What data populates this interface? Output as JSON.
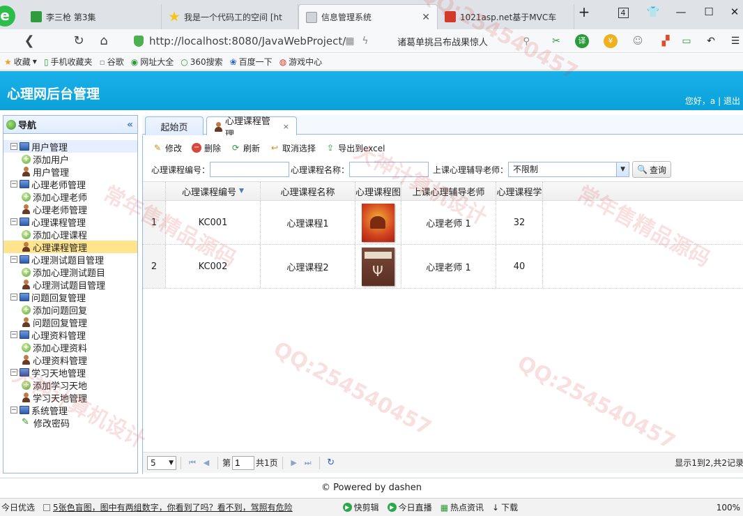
{
  "browser": {
    "tabs": [
      {
        "title": "李三枪 第3集",
        "favicon_color": "#2e9b3c"
      },
      {
        "title": "我是一个代码工的空间 [ht",
        "favicon_color": "#f5c518"
      },
      {
        "title": "信息管理系统",
        "favicon_color": "#9aa0a6"
      },
      {
        "title": "1021asp.net基于MVC车",
        "favicon_color": "#d23a2a"
      }
    ],
    "new_tab": "+",
    "tab_count": "4",
    "url": "http://localhost:8080/JavaWebProject/",
    "search_text": "诸葛单挑吕布战果惊人",
    "bookmarks": [
      "收藏",
      "手机收藏夹",
      "谷歌",
      "网址大全",
      "360搜索",
      "百度一下",
      "游戏中心"
    ]
  },
  "app": {
    "title": "心理网后台管理",
    "greeting": "您好，a",
    "sep": "|",
    "logout": "退出"
  },
  "nav": {
    "title": "导航",
    "collapse": "«",
    "groups": [
      {
        "label": "用户管理",
        "items": [
          {
            "label": "添加用户",
            "icon": "add"
          },
          {
            "label": "用户管理",
            "icon": "user"
          }
        ]
      },
      {
        "label": "心理老师管理",
        "items": [
          {
            "label": "添加心理老师",
            "icon": "add"
          },
          {
            "label": "心理老师管理",
            "icon": "user"
          }
        ]
      },
      {
        "label": "心理课程管理",
        "items": [
          {
            "label": "添加心理课程",
            "icon": "add"
          },
          {
            "label": "心理课程管理",
            "icon": "user"
          }
        ]
      },
      {
        "label": "心理测试题目管理",
        "items": [
          {
            "label": "添加心理测试题目",
            "icon": "add"
          },
          {
            "label": "心理测试题目管理",
            "icon": "user"
          }
        ]
      },
      {
        "label": "问题回复管理",
        "items": [
          {
            "label": "添加问题回复",
            "icon": "add"
          },
          {
            "label": "问题回复管理",
            "icon": "user"
          }
        ]
      },
      {
        "label": "心理资料管理",
        "items": [
          {
            "label": "添加心理资料",
            "icon": "add"
          },
          {
            "label": "心理资料管理",
            "icon": "user"
          }
        ]
      },
      {
        "label": "学习天地管理",
        "items": [
          {
            "label": "添加学习天地",
            "icon": "add"
          },
          {
            "label": "学习天地管理",
            "icon": "user"
          }
        ]
      },
      {
        "label": "系统管理",
        "items": [
          {
            "label": "修改密码",
            "icon": "pen"
          }
        ]
      }
    ]
  },
  "content_tabs": [
    {
      "label": "起始页"
    },
    {
      "label": "心理课程管理",
      "close": "×"
    }
  ],
  "toolbar": {
    "edit": "修改",
    "delete": "删除",
    "refresh": "刷新",
    "unselect": "取消选择",
    "export": "导出到excel"
  },
  "filters": {
    "code_label": "心理课程编号：",
    "code_value": "",
    "name_label": "心理课程名称：",
    "name_value": "",
    "teacher_label": "上课心理辅导老师：",
    "teacher_value": "不限制",
    "query": "查询"
  },
  "grid": {
    "columns": [
      "心理课程编号",
      "心理课程名称",
      "心理课程图",
      "上课心理辅导老师",
      "心理课程学"
    ],
    "rows": [
      {
        "num": "1",
        "code": "KC001",
        "name": "心理课程1",
        "teacher": "心理老师 1",
        "hours": "32"
      },
      {
        "num": "2",
        "code": "KC002",
        "name": "心理课程2",
        "teacher": "心理老师 1",
        "hours": "40"
      }
    ]
  },
  "pager": {
    "page_size": "5",
    "page_prefix": "第",
    "page_value": "1",
    "page_total": "共1页",
    "info": "显示1到2,共2记录"
  },
  "footer": {
    "text": "© Powered by dashen"
  },
  "statusbar": {
    "items": [
      "今日优选",
      "5张色盲图，图中有两组数字，你看到了吗？看不到，驾照有危险",
      "快剪辑",
      "今日直播",
      "热点资讯",
      "下载",
      "100%"
    ]
  },
  "watermarks": [
    "QQ:254540457",
    "常年售精品源码",
    "大神计算机设计"
  ]
}
